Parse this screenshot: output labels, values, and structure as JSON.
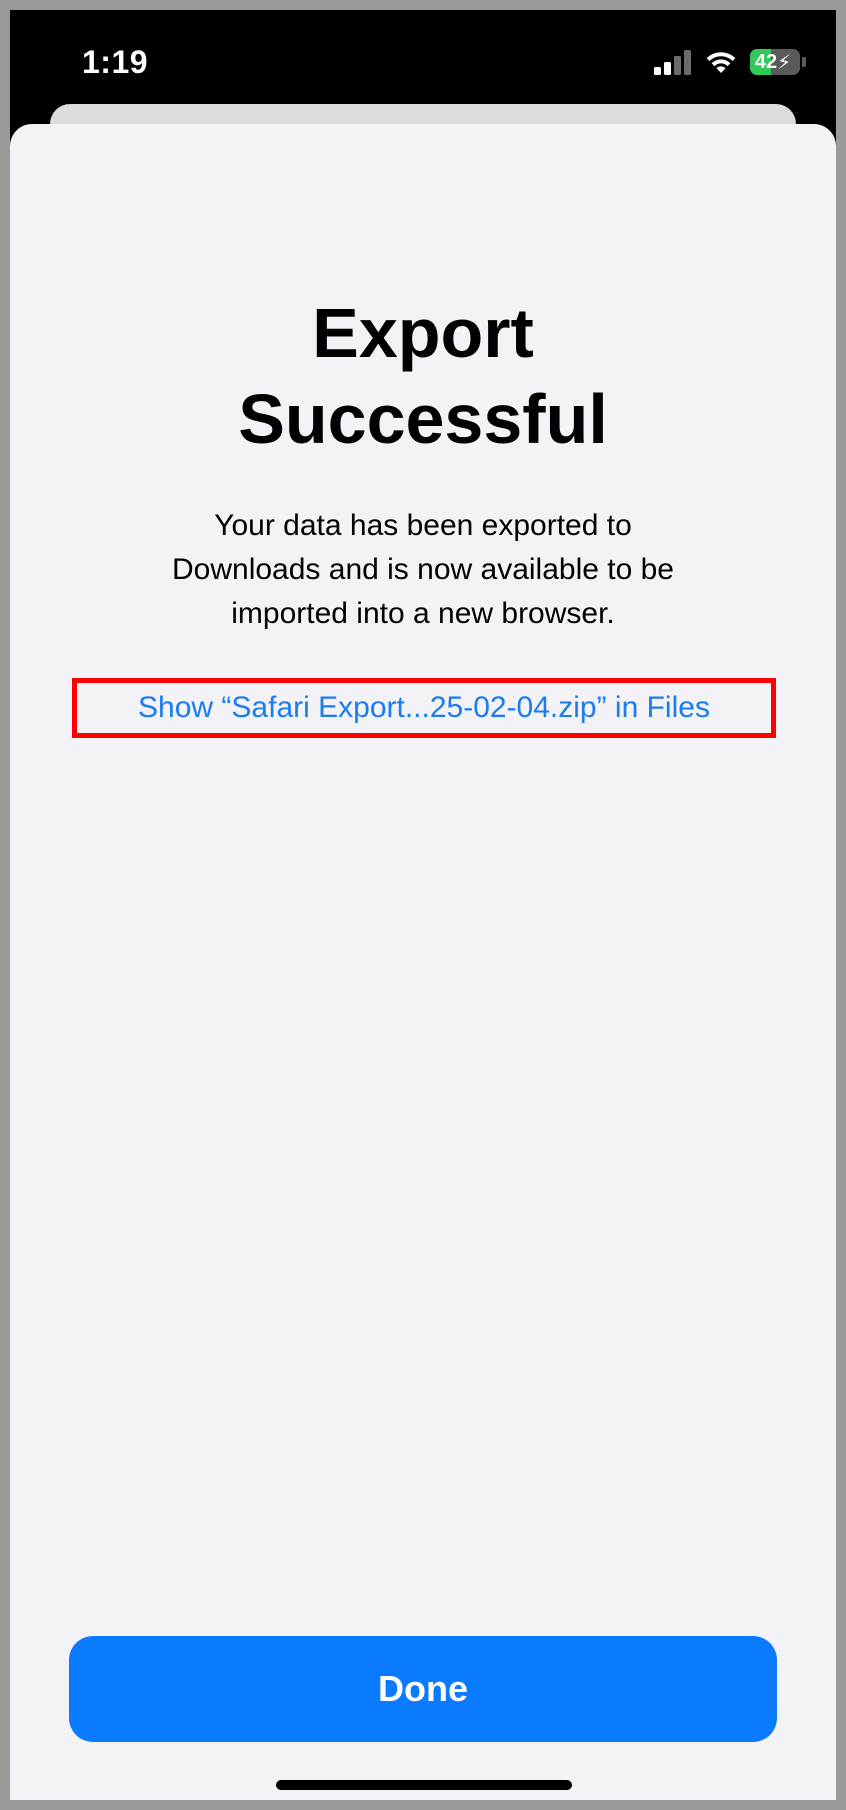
{
  "status_bar": {
    "time": "1:19",
    "battery_level": "42",
    "battery_fraction": 0.42,
    "signal_bars": 2,
    "icons": [
      "signal-icon",
      "wifi-icon",
      "battery-icon"
    ]
  },
  "dialog": {
    "title_line1": "Export",
    "title_line2": "Successful",
    "description_line1": "Your data has been exported to",
    "description_line2": "Downloads and is now available to be",
    "description_line3": "imported into a new browser.",
    "files_link": "Show “Safari Export...25-02-04.zip” in Files",
    "done_label": "Done"
  },
  "colors": {
    "accent": "#0a7bff",
    "link": "#1a7cf0",
    "highlight_border": "#ff0000",
    "sheet_background": "#f2f2f7",
    "battery_green": "#34c759"
  }
}
